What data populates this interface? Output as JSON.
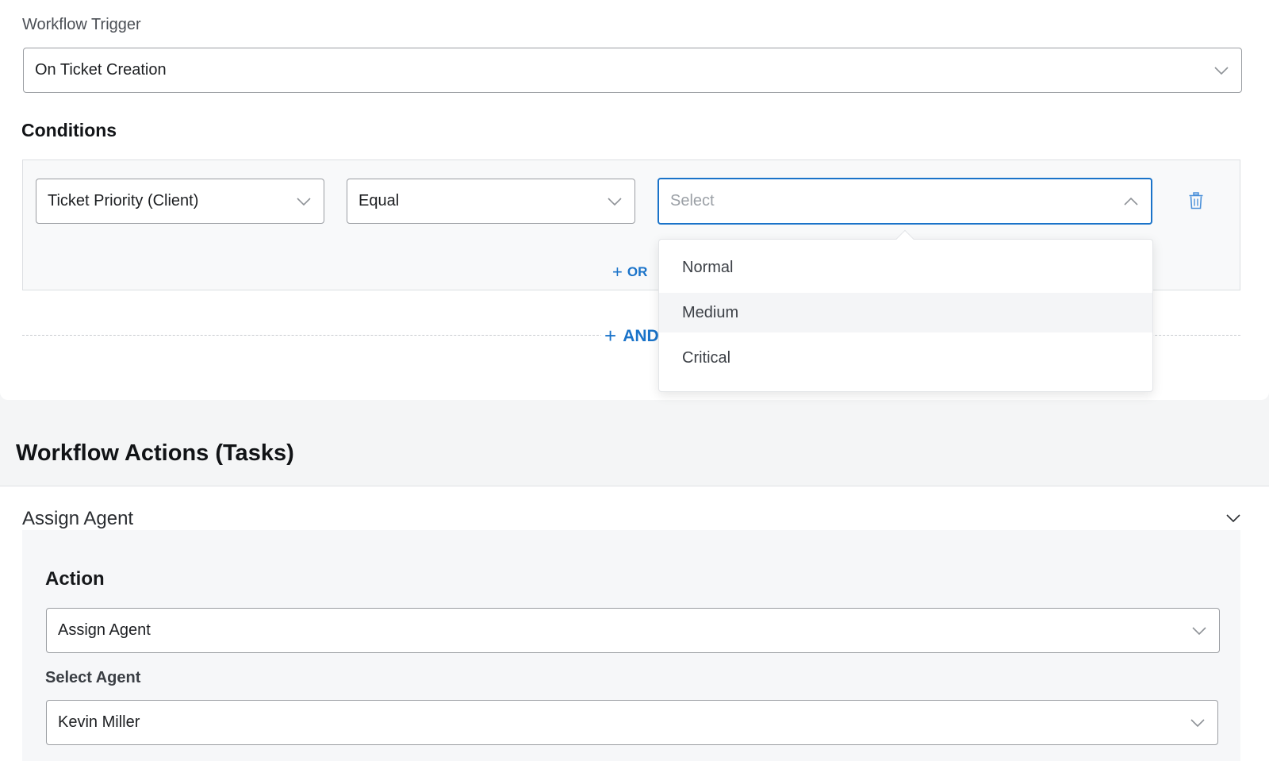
{
  "trigger": {
    "label": "Workflow Trigger",
    "value": "On Ticket Creation"
  },
  "conditions": {
    "title": "Conditions",
    "field": "Ticket Priority (Client)",
    "operator": "Equal",
    "value_placeholder": "Select",
    "or_label": "OR",
    "and_label": "AND"
  },
  "dropdown": {
    "options": [
      "Normal",
      "Medium",
      "Critical"
    ],
    "highlighted": "Medium"
  },
  "actions": {
    "title": "Workflow Actions (Tasks)",
    "task_title": "Assign Agent",
    "action_label": "Action",
    "action_value": "Assign Agent",
    "agent_label": "Select Agent",
    "agent_value": "Kevin Miller"
  },
  "colors": {
    "accent": "#1a73c9",
    "border": "#9a9da2",
    "panel": "#f8f9fa"
  }
}
